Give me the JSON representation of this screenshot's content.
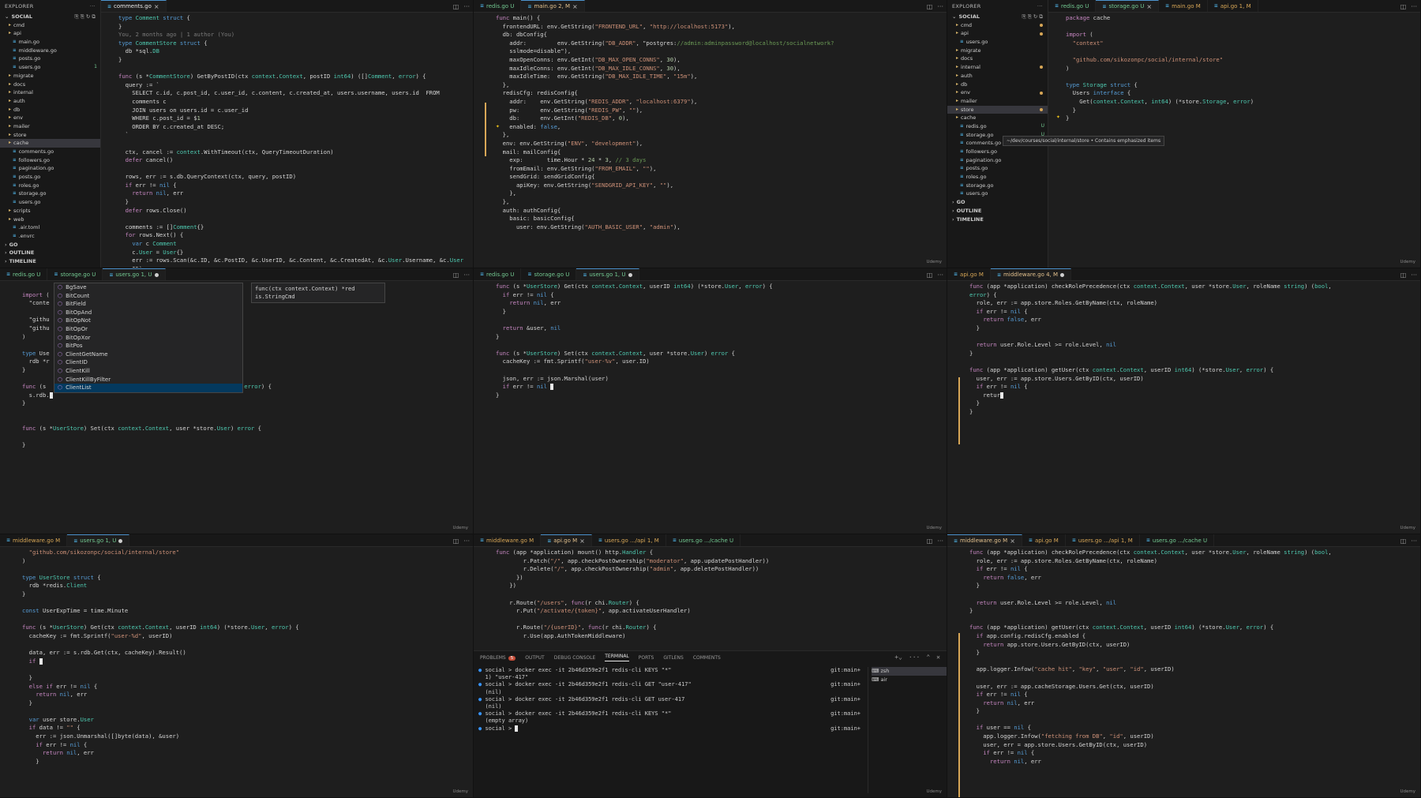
{
  "explorer_left": {
    "header": "EXPLORER",
    "root": "SOCIAL",
    "items": [
      {
        "label": "cmd",
        "type": "folder"
      },
      {
        "label": "api",
        "type": "folder"
      },
      {
        "label": "main.go",
        "type": "file"
      },
      {
        "label": "middleware.go",
        "type": "file"
      },
      {
        "label": "posts.go",
        "type": "file"
      },
      {
        "label": "users.go",
        "type": "file",
        "mark": "1"
      },
      {
        "label": "migrate",
        "type": "folder"
      },
      {
        "label": "docs",
        "type": "folder"
      },
      {
        "label": "internal",
        "type": "folder"
      },
      {
        "label": "auth",
        "type": "folder"
      },
      {
        "label": "db",
        "type": "folder"
      },
      {
        "label": "env",
        "type": "folder"
      },
      {
        "label": "mailer",
        "type": "folder"
      },
      {
        "label": "store",
        "type": "folder"
      },
      {
        "label": "cache",
        "type": "folder",
        "selected": true
      },
      {
        "label": "comments.go",
        "type": "file"
      },
      {
        "label": "followers.go",
        "type": "file"
      },
      {
        "label": "pagination.go",
        "type": "file"
      },
      {
        "label": "posts.go",
        "type": "file"
      },
      {
        "label": "roles.go",
        "type": "file"
      },
      {
        "label": "storage.go",
        "type": "file"
      },
      {
        "label": "users.go",
        "type": "file"
      },
      {
        "label": "scripts",
        "type": "folder"
      },
      {
        "label": "web",
        "type": "folder"
      },
      {
        "label": ".air.toml",
        "type": "file"
      },
      {
        "label": ".envrc",
        "type": "file"
      },
      {
        "label": "GO",
        "type": "section"
      },
      {
        "label": "OUTLINE",
        "type": "section"
      },
      {
        "label": "TIMELINE",
        "type": "section"
      }
    ]
  },
  "explorer_right": {
    "header": "EXPLORER",
    "root": "SOCIAL",
    "items": [
      {
        "label": "cmd",
        "type": "folder",
        "mdot": true
      },
      {
        "label": "api",
        "type": "folder",
        "mdot": true
      },
      {
        "label": "users.go",
        "type": "file"
      },
      {
        "label": "migrate",
        "type": "folder"
      },
      {
        "label": "docs",
        "type": "folder"
      },
      {
        "label": "internal",
        "type": "folder",
        "mdot": true
      },
      {
        "label": "auth",
        "type": "folder"
      },
      {
        "label": "db",
        "type": "folder"
      },
      {
        "label": "env",
        "type": "folder",
        "mdot": true
      },
      {
        "label": "mailer",
        "type": "folder"
      },
      {
        "label": "store",
        "type": "folder",
        "mdot": true,
        "selected": true
      },
      {
        "label": "cache",
        "type": "folder"
      },
      {
        "label": "redis.go",
        "type": "file",
        "mark": "U"
      },
      {
        "label": "storage.go",
        "type": "file",
        "mark": "U"
      },
      {
        "label": "comments.go",
        "type": "file"
      },
      {
        "label": "followers.go",
        "type": "file"
      },
      {
        "label": "pagination.go",
        "type": "file"
      },
      {
        "label": "posts.go",
        "type": "file"
      },
      {
        "label": "roles.go",
        "type": "file"
      },
      {
        "label": "storage.go",
        "type": "file"
      },
      {
        "label": "users.go",
        "type": "file"
      },
      {
        "label": "GO",
        "type": "section"
      },
      {
        "label": "OUTLINE",
        "type": "section"
      },
      {
        "label": "TIMELINE",
        "type": "section"
      }
    ],
    "tooltip": "~/dev/courses/social/internal/store • Contains emphasized items"
  },
  "panes": {
    "p11": {
      "tabs": [
        {
          "label": "comments.go",
          "active": true,
          "close": true
        }
      ]
    },
    "p12": {
      "tabs": [
        {
          "label": "redis.go U"
        },
        {
          "label": "main.go 2, M",
          "active": true,
          "close": true
        }
      ]
    },
    "p13": {
      "tabs": [
        {
          "label": "redis.go U"
        },
        {
          "label": "storage.go U",
          "active": true,
          "close": true
        },
        {
          "label": "main.go M"
        },
        {
          "label": "api.go 1, M"
        }
      ]
    },
    "p21": {
      "tabs": [
        {
          "label": "redis.go U"
        },
        {
          "label": "storage.go U"
        },
        {
          "label": "users.go 1, U",
          "active": true,
          "dot": true
        }
      ]
    },
    "p22": {
      "tabs": [
        {
          "label": "redis.go U"
        },
        {
          "label": "storage.go U"
        },
        {
          "label": "users.go 1, U",
          "active": true,
          "dot": true
        }
      ]
    },
    "p23": {
      "tabs": [
        {
          "label": "api.go M"
        },
        {
          "label": "middleware.go 4, M",
          "active": true,
          "dot": true
        }
      ]
    },
    "p31": {
      "tabs": [
        {
          "label": "middleware.go M"
        },
        {
          "label": "users.go 1, U",
          "active": true,
          "dot": true
        }
      ]
    },
    "p32": {
      "tabs": [
        {
          "label": "middleware.go M"
        },
        {
          "label": "api.go M",
          "active": true,
          "close": true
        },
        {
          "label": "users.go .../api 1, M"
        },
        {
          "label": "users.go .../cache U"
        }
      ]
    },
    "p33": {
      "tabs": [
        {
          "label": "middleware.go M",
          "active": true,
          "close": true
        },
        {
          "label": "api.go M"
        },
        {
          "label": "users.go .../api 1, M"
        },
        {
          "label": "users.go .../cache U"
        }
      ]
    }
  },
  "code": {
    "p11": [
      "type Comment struct {",
      "}",
      "You, 2 months ago | 1 author (You)",
      "type CommentStore struct {",
      "  db *sql.DB",
      "}",
      "",
      "func (s *CommentStore) GetByPostID(ctx context.Context, postID int64) ([]Comment, error) {",
      "  query := `",
      "    SELECT c.id, c.post_id, c.user_id, c.content, c.created_at, users.username, users.id  FROM",
      "    comments c",
      "    JOIN users on users.id = c.user_id",
      "    WHERE c.post_id = $1",
      "    ORDER BY c.created_at DESC;",
      "  `",
      "",
      "  ctx, cancel := context.WithTimeout(ctx, QueryTimeoutDuration)",
      "  defer cancel()",
      "",
      "  rows, err := s.db.QueryContext(ctx, query, postID)",
      "  if err != nil {",
      "    return nil, err",
      "  }",
      "  defer rows.Close()",
      "",
      "  comments := []Comment{}",
      "  for rows.Next() {",
      "    var c Comment",
      "    c.User = User{}",
      "    err := rows.Scan(&c.ID, &c.PostID, &c.UserID, &c.Content, &c.CreatedAt, &c.User.Username, &c.User",
      "    ID)"
    ],
    "p12": [
      "func main() {",
      "  frontendURL: env.GetString(\"FRONTEND_URL\", \"http://localhost:5173\"),",
      "  db: dbConfig{",
      "    addr:         env.GetString(\"DB_ADDR\", \"postgres://admin:adminpassword@localhost/socialnetwork?",
      "    sslmode=disable\"),",
      "    maxOpenConns: env.GetInt(\"DB_MAX_OPEN_CONNS\", 30),",
      "    maxIdleConns: env.GetInt(\"DB_MAX_IDLE_CONNS\", 30),",
      "    maxIdleTime:  env.GetString(\"DB_MAX_IDLE_TIME\", \"15m\"),",
      "  },",
      "  redisCfg: redisConfig{",
      "    addr:    env.GetString(\"REDIS_ADDR\", \"localhost:6379\"),",
      "    pw:      env.GetString(\"REDIS_PW\", \"\"),",
      "    db:      env.GetInt(\"REDIS_DB\", 0),",
      "    enabled: false,",
      "  },",
      "  env: env.GetString(\"ENV\", \"development\"),",
      "  mail: mailConfig{",
      "    exp:       time.Hour * 24 * 3, // 3 days",
      "    fromEmail: env.GetString(\"FROM_EMAIL\", \"\"),",
      "    sendGrid: sendGridConfig{",
      "      apiKey: env.GetString(\"SENDGRID_API_KEY\", \"\"),",
      "    },",
      "  },",
      "  auth: authConfig{",
      "    basic: basicConfig{",
      "      user: env.GetString(\"AUTH_BASIC_USER\", \"admin\"),"
    ],
    "p13": [
      "package cache",
      "",
      "import (",
      "  \"context\"",
      "",
      "  \"github.com/sikozonpc/social/internal/store\"",
      ")",
      "",
      "type Storage struct {",
      "  Users interface {",
      "    Get(context.Context, int64) (*store.Storage, error)",
      "  }",
      "}"
    ],
    "p21": [
      "",
      "import (",
      "  \"conte",
      "",
      "  \"githu",
      "  \"githu",
      ")",
      "",
      "type Use",
      "  rdb *r",
      "}",
      "",
      "func (s                                          ) (*store.User, error) {",
      "  s.rdb.",
      "}",
      "",
      "",
      "func (s *UserStore) Set(ctx context.Context, user *store.User) error {",
      "",
      "}"
    ],
    "p22": [
      "func (s *UserStore) Get(ctx context.Context, userID int64) (*store.User, error) {",
      "  if err != nil {",
      "    return nil, err",
      "  }",
      "",
      "  return &user, nil",
      "}",
      "",
      "func (s *UserStore) Set(ctx context.Context, user *store.User) error {",
      "  cacheKey := fmt.Sprintf(\"user-%v\", user.ID)",
      "",
      "  json, err := json.Marshal(user)",
      "  if err != nil ",
      "}"
    ],
    "p23": [
      "error) {",
      "  role, err := app.store.Roles.GetByName(ctx, roleName)",
      "  if err != nil {",
      "    return false, err",
      "  }",
      "",
      "  return user.Role.Level >= role.Level, nil",
      "}",
      "",
      "func (app *application) getUser(ctx context.Context, userID int64) (*store.User, error) {",
      "  user, err := app.store.Users.GetByID(ctx, userID)",
      "  if err != nil {",
      "    retur",
      "  }",
      "}"
    ],
    "p23_first": "func (app *application) checkRolePrecedence(ctx context.Context, user *store.User, roleName string) (bool,",
    "p31": [
      "  \"github.com/sikozonpc/social/internal/store\"",
      ")",
      "",
      "type UserStore struct {",
      "  rdb *redis.Client",
      "}",
      "",
      "const UserExpTime = time.Minute",
      "",
      "func (s *UserStore) Get(ctx context.Context, userID int64) (*store.User, error) {",
      "  cacheKey := fmt.Sprintf(\"user-%d\", userID)",
      "",
      "  data, err := s.rdb.Get(ctx, cacheKey).Result()",
      "  if ",
      "",
      "  }",
      "  else if err != nil {",
      "    return nil, err",
      "  }",
      "",
      "  var user store.User",
      "  if data != \"\" {",
      "    err := json.Unmarshal([]byte(data), &user)",
      "    if err != nil {",
      "      return nil, err",
      "    }"
    ],
    "p32": [
      "func (app *application) mount() http.Handler {",
      "        r.Patch(\"/\", app.checkPostOwnership(\"moderator\", app.updatePostHandler))",
      "        r.Delete(\"/\", app.checkPostOwnership(\"admin\", app.deletePostHandler))",
      "      })",
      "    })",
      "",
      "    r.Route(\"/users\", func(r chi.Router) {",
      "      r.Put(\"/activate/{token}\", app.activateUserHandler)",
      "",
      "      r.Route(\"/{userID}\", func(r chi.Router) {",
      "        r.Use(app.AuthTokenMiddleware)"
    ],
    "p33": [
      "func (app *application) checkRolePrecedence(ctx context.Context, user *store.User, roleName string) (bool,",
      "  role, err := app.store.Roles.GetByName(ctx, roleName)",
      "  if err != nil {",
      "    return false, err",
      "  }",
      "",
      "  return user.Role.Level >= role.Level, nil",
      "}",
      "",
      "func (app *application) getUser(ctx context.Context, userID int64) (*store.User, error) {",
      "  if app.config.redisCfg.enabled {",
      "    return app.store.Users.GetByID(ctx, userID)",
      "  }",
      "",
      "  app.logger.Infow(\"cache hit\", \"key\", \"user\", \"id\", userID)",
      "",
      "  user, err := app.cacheStorage.Users.Get(ctx, userID)",
      "  if err != nil {",
      "    return nil, err",
      "  }",
      "",
      "  if user == nil {",
      "    app.logger.Infow(\"fetching from DB\", \"id\", userID)",
      "    user, err = app.store.Users.GetByID(ctx, userID)",
      "    if err != nil {",
      "      return nil, err"
    ]
  },
  "autocomplete": {
    "items": [
      "BgSave",
      "BitCount",
      "BitField",
      "BitOpAnd",
      "BitOpNot",
      "BitOpOr",
      "BitOpXor",
      "BitPos",
      "ClientGetName",
      "ClientID",
      "ClientKill",
      "ClientKillByFilter",
      "ClientList"
    ],
    "signature": "func(ctx context.Context) *red\nis.StringCmd"
  },
  "terminal": {
    "tabs": [
      "PROBLEMS",
      "OUTPUT",
      "DEBUG CONSOLE",
      "TERMINAL",
      "PORTS",
      "GITLENS",
      "COMMENTS"
    ],
    "active_tab": "TERMINAL",
    "problems_count": "5",
    "lines": [
      {
        "text": "social > docker exec -it 2b46d359e2f1 redis-cli KEYS \"*\"",
        "branch": "git:main+",
        "prompt": true
      },
      {
        "text": "1) \"user-417\"",
        "branch": ""
      },
      {
        "text": "social > docker exec -it 2b46d359e2f1 redis-cli GET \"user-417\"",
        "branch": "git:main+",
        "prompt": true
      },
      {
        "text": "(nil)",
        "branch": ""
      },
      {
        "text": "social > docker exec -it 2b46d359e2f1 redis-cli GET user-417",
        "branch": "git:main+",
        "prompt": true
      },
      {
        "text": "(nil)",
        "branch": ""
      },
      {
        "text": "social > docker exec -it 2b46d359e2f1 redis-cli KEYS \"*\"",
        "branch": "git:main+",
        "prompt": true
      },
      {
        "text": "(empty array)",
        "branch": ""
      },
      {
        "text": "social > ",
        "branch": "git:main+",
        "prompt": true
      }
    ],
    "shells": [
      "zsh",
      "air"
    ]
  },
  "watermark": "Udemy"
}
